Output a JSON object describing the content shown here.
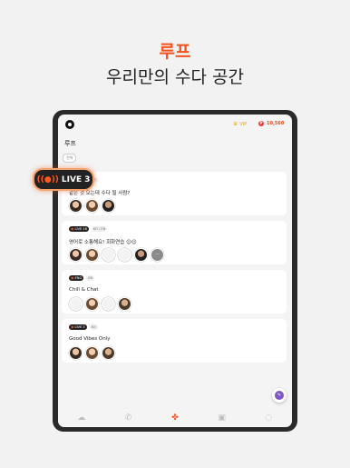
{
  "hero": {
    "title": "루프",
    "subtitle": "우리만의 수다 공간"
  },
  "topbar": {
    "vip_label": "VIP",
    "coins": "10,560"
  },
  "page": {
    "title": "루프",
    "filter_chip": "전체"
  },
  "live_pill": {
    "label": "LIVE",
    "count": "3"
  },
  "rooms": [
    {
      "live_label": "LIVE",
      "live_count": "3",
      "tag": "KO",
      "title": "같은 것 오는데 수다 될 사람?",
      "avatars": 3
    },
    {
      "live_label": "LIVE",
      "live_count": "16",
      "tag": "KO / EN",
      "title": "영어로 소통해요! 회화연습 ☺☺",
      "avatars": 7
    },
    {
      "live_label": "ENG",
      "live_count": "",
      "tag": "EN",
      "title": "Chill & Chat",
      "avatars": 4
    },
    {
      "live_label": "LIVE",
      "live_count": "3",
      "tag": "KO",
      "title": "Good Vibes Only",
      "avatars": 3
    }
  ],
  "more_label": "···",
  "fab_label": "✎",
  "nav": {
    "items": [
      "home-icon",
      "call-icon",
      "loop-icon",
      "gallery-icon",
      "chat-icon"
    ],
    "active": "loop-icon"
  },
  "colors": {
    "accent": "#f4511e",
    "live_glow": "#f5a36c",
    "fab": "#7e57c2"
  }
}
